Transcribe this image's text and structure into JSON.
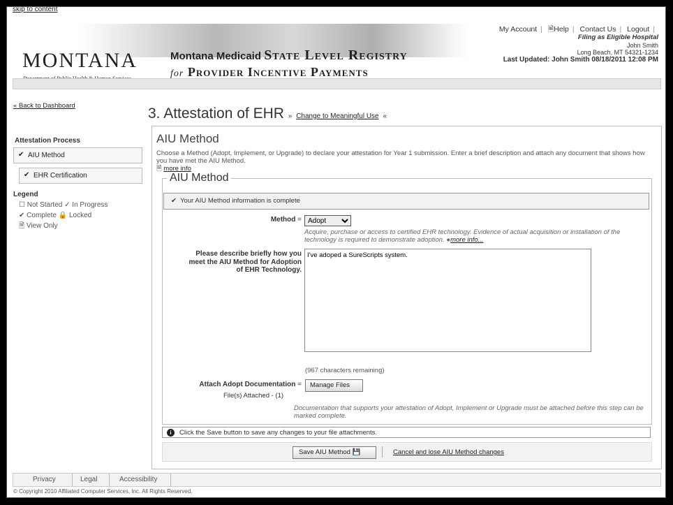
{
  "skip_link": "skip to content",
  "logo": {
    "name": "MONTANA",
    "dept": "Department of Public Health & Human Services"
  },
  "brand": {
    "line1_a": "Montana Medicaid",
    "line1_b": "State Level Registry",
    "line2_a": "for",
    "line2_b": "Provider Incentive Payments"
  },
  "topnav": {
    "my_account": "My Account",
    "help": "Help",
    "contact": "Contact Us",
    "logout": "Logout"
  },
  "user": {
    "filing": "Filing as Eligible Hospital",
    "name": "John Smith",
    "location": "Long Beach, MT 54321-1234",
    "updated": "Last Updated: John Smith 08/18/2011 12:08 PM"
  },
  "back_link": "« Back to Dashboard",
  "page": {
    "title": "3. Attestation of EHR",
    "change_prefix": "»",
    "change_link": "Change to Meaningful Use",
    "change_suffix": "«"
  },
  "sidebar": {
    "header": "Attestation Process",
    "items": [
      {
        "label": "AIU Method"
      },
      {
        "label": "EHR Certification"
      }
    ],
    "legend_header": "Legend",
    "legend": {
      "not_started": "Not Started",
      "in_progress": "In Progress",
      "complete": "Complete",
      "locked": "Locked",
      "view_only": "View Only"
    }
  },
  "main": {
    "heading": "AIU Method",
    "intro": "Choose a Method (Adopt, Implement, or Upgrade) to declare your attestation for Year 1 submission. Enter a brief description and attach any document that shows how you have met the AIU Method.",
    "more_info": "more info",
    "fieldset_title": "AIU Method",
    "complete_msg": "Your AIU Method information is complete",
    "method_label": "Method",
    "method_value": "Adopt",
    "method_hint": "Acquire, purchase or access to certified EHR technology. Evidence of actual acquisition or installation of the technology is required to demonstrate adoption.",
    "method_more": "more info...",
    "describe_label": "Please describe briefly how you meet the AIU Method for Adoption of EHR Technology.",
    "describe_value": "I've adoped a SureScripts system.",
    "remaining": "(967 characters remaining)",
    "attach_label": "Attach Adopt Documentation",
    "manage_files": "Manage Files",
    "files_attached": "File(s) Attached - (1)",
    "attach_hint": "Documentation that supports your attestation of Adopt, Implement or Upgrade must be attached before this step can be marked complete.",
    "info_msg": "Click the Save button to save any changes to your file attachments.",
    "save_button": "Save AIU Method",
    "cancel_link": "Cancel and lose AIU Method changes"
  },
  "footer": {
    "privacy": "Privacy",
    "legal": "Legal",
    "accessibility": "Accessibility",
    "copyright": "© Copyright 2010 Affiliated Computer Services, Inc. All Rights Reserved."
  }
}
